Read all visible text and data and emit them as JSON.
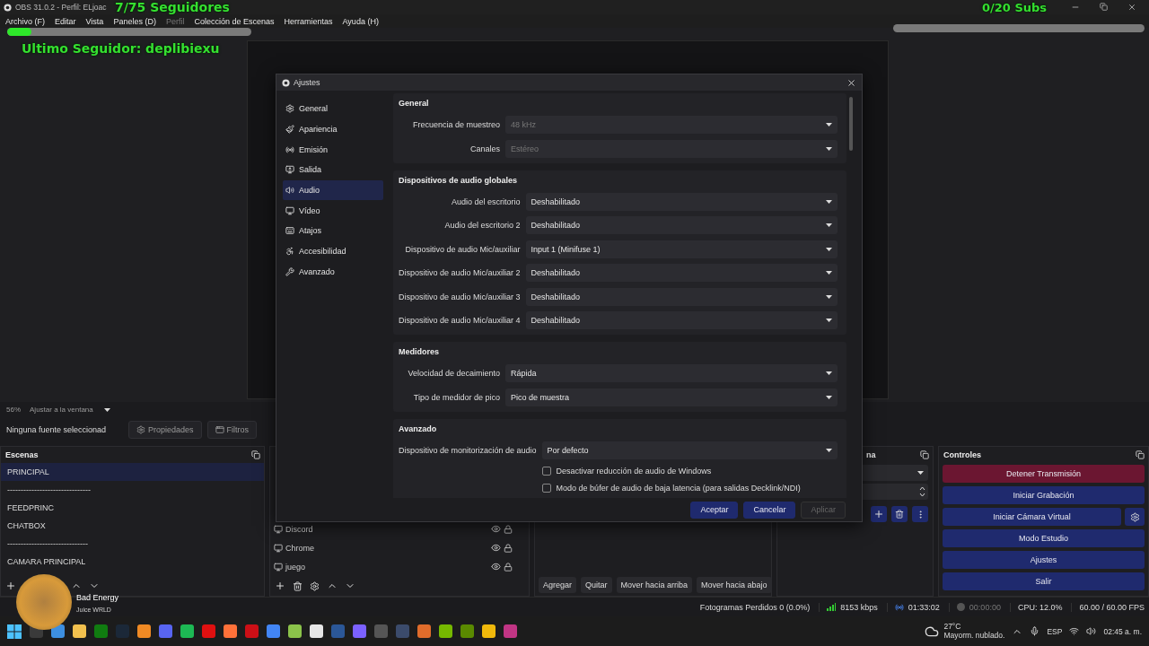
{
  "titlebar": {
    "title": "OBS 31.0.2 - Perfil: ELjoac"
  },
  "menu": [
    {
      "label": "Archivo (F)",
      "disabled": false
    },
    {
      "label": "Editar",
      "disabled": false
    },
    {
      "label": "Vista",
      "disabled": false
    },
    {
      "label": "Paneles (D)",
      "disabled": false
    },
    {
      "label": "Perfil",
      "disabled": true
    },
    {
      "label": "Colección de Escenas",
      "disabled": false
    },
    {
      "label": "Herramientas",
      "disabled": false
    },
    {
      "label": "Ayuda (H)",
      "disabled": false
    }
  ],
  "overlays": {
    "followers": {
      "text": "7/75 Seguidores",
      "level": 0.1
    },
    "last_follower": "Ultimo Seguidor: deplibiexu",
    "subs": {
      "text": "0/20 Subs",
      "level": 0
    }
  },
  "preview": {
    "zoom": "56%",
    "fit": "Ajustar a la ventana"
  },
  "source_bar": {
    "label": "Ninguna fuente seleccionad",
    "properties": "Propiedades",
    "filters": "Filtros"
  },
  "scenes": {
    "title": "Escenas",
    "items": [
      {
        "name": "PRINCIPAL",
        "selected": true
      },
      {
        "name": "-------------------------------",
        "selected": false
      },
      {
        "name": "FEEDPRINC",
        "selected": false
      },
      {
        "name": "CHATBOX",
        "selected": false
      },
      {
        "name": "------------------------------",
        "selected": false
      },
      {
        "name": "CAMARA PRINCIPAL",
        "selected": false
      }
    ]
  },
  "sources": {
    "items": [
      {
        "name": "Discord"
      },
      {
        "name": "Chrome"
      },
      {
        "name": "juego"
      }
    ]
  },
  "mixer": {
    "buttons": [
      "Agregar",
      "Quitar",
      "Mover hacia arriba",
      "Mover hacia abajo"
    ]
  },
  "transitions": {
    "title": "na"
  },
  "controls": {
    "title": "Controles",
    "buttons": [
      {
        "label": "Detener Transmisión",
        "kind": "stop"
      },
      {
        "label": "Iniciar Grabación",
        "kind": "normal"
      },
      {
        "label": "Iniciar Cámara Virtual",
        "kind": "config"
      },
      {
        "label": "Modo Estudio",
        "kind": "normal"
      },
      {
        "label": "Ajustes",
        "kind": "normal"
      },
      {
        "label": "Salir",
        "kind": "normal"
      }
    ]
  },
  "status_bar": {
    "dropped": "Fotogramas Perdidos 0 (0.0%)",
    "bitrate": "8153 kbps",
    "stream_time": "01:33:02",
    "record_time": "00:00:00",
    "cpu": "CPU: 12.0%",
    "fps": "60.00 / 60.00 FPS"
  },
  "now_playing": {
    "title": "Bad Energy",
    "artist": "Juice WRLD"
  },
  "taskbar": {
    "temp": "27°C",
    "weather": "Mayorm. nublado.",
    "language": "ESP",
    "time": "02:45 a. m."
  },
  "dialog": {
    "title": "Ajustes",
    "nav": [
      {
        "label": "General",
        "selected": false
      },
      {
        "label": "Apariencia",
        "selected": false
      },
      {
        "label": "Emisión",
        "selected": false
      },
      {
        "label": "Salida",
        "selected": false
      },
      {
        "label": "Audio",
        "selected": true
      },
      {
        "label": "Vídeo",
        "selected": false
      },
      {
        "label": "Atajos",
        "selected": false
      },
      {
        "label": "Accesibilidad",
        "selected": false
      },
      {
        "label": "Avanzado",
        "selected": false
      }
    ],
    "sections": [
      {
        "title": "General",
        "rows": [
          {
            "label": "Frecuencia de muestreo",
            "value": "48 kHz",
            "disabled": true
          },
          {
            "label": "Canales",
            "value": "Estéreo",
            "disabled": true
          }
        ]
      },
      {
        "title": "Dispositivos de audio globales",
        "rows": [
          {
            "label": "Audio del escritorio",
            "value": "Deshabilitado",
            "disabled": false
          },
          {
            "label": "Audio del escritorio 2",
            "value": "Deshabilitado",
            "disabled": false
          },
          {
            "label": "Dispositivo de audio Mic/auxiliar",
            "value": "Input 1 (Minifuse 1)",
            "disabled": false
          },
          {
            "label": "Dispositivo de audio Mic/auxiliar 2",
            "value": "Deshabilitado",
            "disabled": false
          },
          {
            "label": "Dispositivo de audio Mic/auxiliar 3",
            "value": "Deshabilitado",
            "disabled": false
          },
          {
            "label": "Dispositivo de audio Mic/auxiliar 4",
            "value": "Deshabilitado",
            "disabled": false
          }
        ]
      },
      {
        "title": "Medidores",
        "rows": [
          {
            "label": "Velocidad de decaimiento",
            "value": "Rápida",
            "disabled": false
          },
          {
            "label": "Tipo de medidor de pico",
            "value": "Pico de muestra",
            "disabled": false
          }
        ]
      },
      {
        "title": "Avanzado",
        "rows": [
          {
            "label": "Dispositivo de monitorización de audio",
            "value": "Por defecto",
            "disabled": false
          }
        ],
        "checkboxes": [
          {
            "label": "Desactivar reducción de audio de Windows",
            "checked": false
          },
          {
            "label": "Modo de búfer de audio de baja latencia (para salidas Decklink/NDI)",
            "checked": false
          }
        ]
      }
    ],
    "buttons": [
      {
        "label": "Aceptar",
        "disabled": false
      },
      {
        "label": "Cancelar",
        "disabled": false
      },
      {
        "label": "Aplicar",
        "disabled": true
      }
    ]
  }
}
